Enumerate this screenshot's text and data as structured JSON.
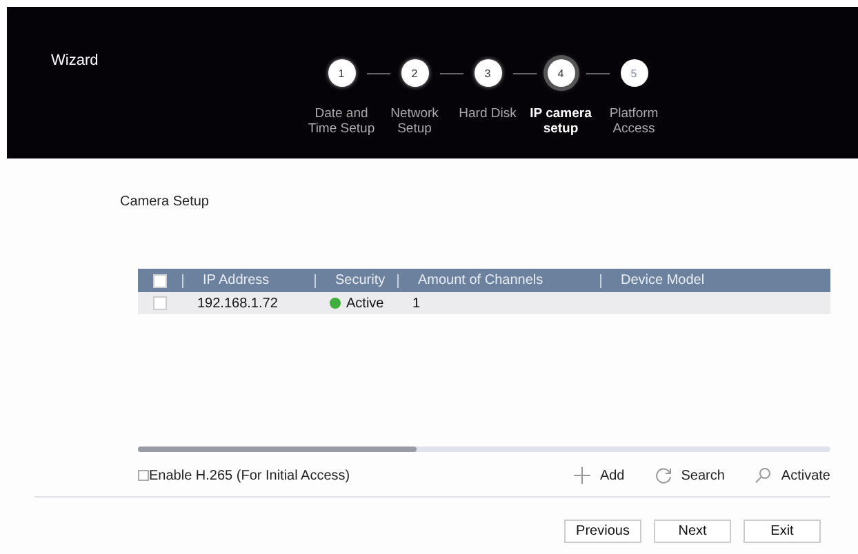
{
  "window": {
    "title": "Wizard"
  },
  "steps": [
    {
      "number": "1",
      "label": "Date and Time Setup",
      "selected": false
    },
    {
      "number": "2",
      "label": "Network Setup",
      "selected": false
    },
    {
      "number": "3",
      "label": "Hard Disk",
      "selected": false
    },
    {
      "number": "4",
      "label": "IP camera setup",
      "selected": true
    },
    {
      "number": "5",
      "label": "Platform Access",
      "selected": false
    }
  ],
  "section_title": "Camera Setup",
  "table": {
    "select_all_checked": false,
    "columns": [
      "IP Address",
      "Security",
      "Amount of Channels",
      "Device Model"
    ],
    "rows": [
      {
        "checked": false,
        "ip": "192.168.1.72",
        "security": "Active",
        "color": "#3fae3a",
        "channels": "1"
      }
    ]
  },
  "h265": {
    "label": "Enable H.265 (For Initial Access)",
    "checked": false
  },
  "actions": [
    {
      "kind": "add",
      "label": "Add"
    },
    {
      "kind": "search",
      "label": "Search"
    },
    {
      "kind": "activate",
      "label": "Activate"
    }
  ],
  "buttons": [
    "Previous",
    "Next",
    "Exit"
  ]
}
